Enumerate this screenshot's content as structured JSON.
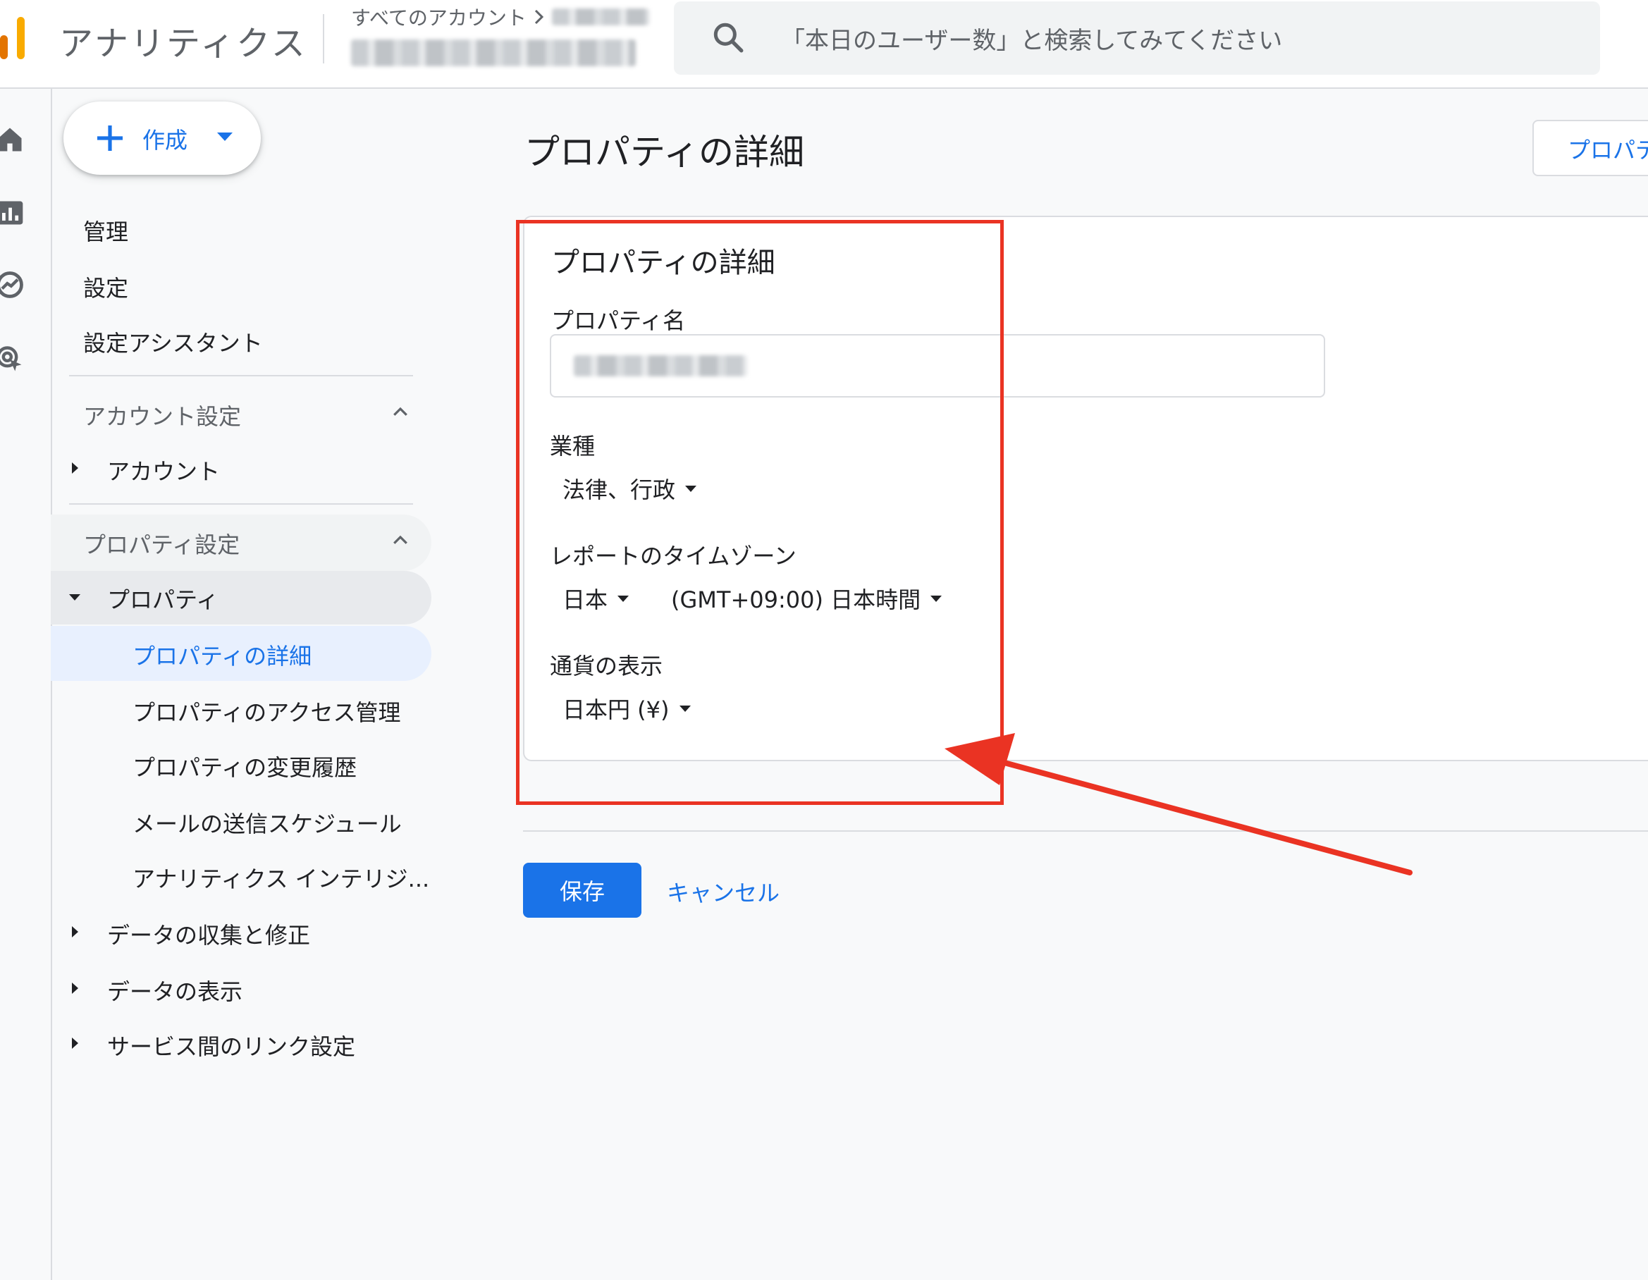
{
  "header": {
    "app_title": "アナリティクス",
    "breadcrumb_label": "すべてのアカウント",
    "search_placeholder": "「本日のユーザー数」と検索してみてください"
  },
  "rail": {
    "icons": [
      "home-icon",
      "reports-icon",
      "explore-icon",
      "advertising-icon"
    ]
  },
  "create_button": {
    "label": "作成"
  },
  "sidebar": {
    "top_items": [
      "管理",
      "設定",
      "設定アシスタント"
    ],
    "account_section": {
      "title": "アカウント設定",
      "items": [
        "アカウント"
      ]
    },
    "property_section": {
      "title": "プロパティ設定",
      "expanded_item": "プロパティ",
      "sub_items": [
        "プロパティの詳細",
        "プロパティのアクセス管理",
        "プロパティの変更履歴",
        "メールの送信スケジュール",
        "アナリティクス インテリジ..."
      ],
      "selected_sub_item": "プロパティの詳細",
      "collapsed_items": [
        "データの収集と修正",
        "データの表示",
        "サービス間のリンク設定"
      ]
    }
  },
  "main": {
    "page_title": "プロパティの詳細",
    "top_right_button": "プロパテ",
    "card": {
      "title": "プロパティの詳細",
      "property_name_label": "プロパティ名",
      "industry_label": "業種",
      "industry_value": "法律、行政",
      "timezone_label": "レポートのタイムゾーン",
      "timezone_country": "日本",
      "timezone_value": "(GMT+09:00) 日本時間",
      "currency_label": "通貨の表示",
      "currency_value": "日本円 (¥)"
    },
    "save_button": "保存",
    "cancel_link": "キャンセル"
  },
  "colors": {
    "accent": "#1a73e8",
    "annotation": "#ea3323",
    "logo": [
      "#f9ab00",
      "#e37400"
    ]
  }
}
